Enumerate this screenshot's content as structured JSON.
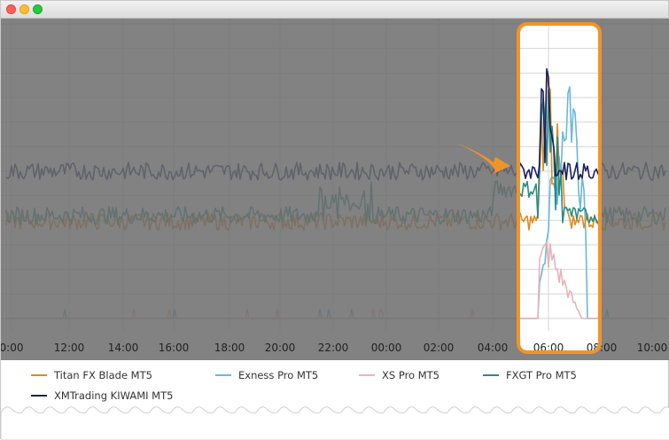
{
  "window": {
    "controls": [
      "close",
      "minimize",
      "maximize"
    ]
  },
  "chart_data": {
    "type": "line",
    "x_tick_labels": [
      "0:00",
      "12:00",
      "14:00",
      "16:00",
      "18:00",
      "20:00",
      "22:00",
      "00:00",
      "02:00",
      "04:00",
      "06:00",
      "08:00",
      "10:00"
    ],
    "series": [
      {
        "name": "Titan FX Blade MT5",
        "color": "#e08a1e",
        "typical": 0.33,
        "peak": 0.95
      },
      {
        "name": "Exness Pro MT5",
        "color": "#6bb8d8",
        "typical": 0.0,
        "peak": 1.0
      },
      {
        "name": "XS Pro MT5",
        "color": "#e8b4b8",
        "typical": 0.0,
        "peak": 0.3
      },
      {
        "name": "FXGT Pro MT5",
        "color": "#2a8c84",
        "typical": 0.35,
        "peak": 0.88
      },
      {
        "name": "XMTrading KIWAMI MT5",
        "color": "#1a1f5e",
        "typical": 0.5,
        "peak": 0.93
      }
    ],
    "highlight_window": {
      "from": "05:30",
      "to": "07:30"
    },
    "grid": true,
    "legend_position": "bottom"
  },
  "colors": {
    "overlay": "#6d6d6d",
    "highlight_border": "#f0942a",
    "arrow": "#f0942a"
  }
}
